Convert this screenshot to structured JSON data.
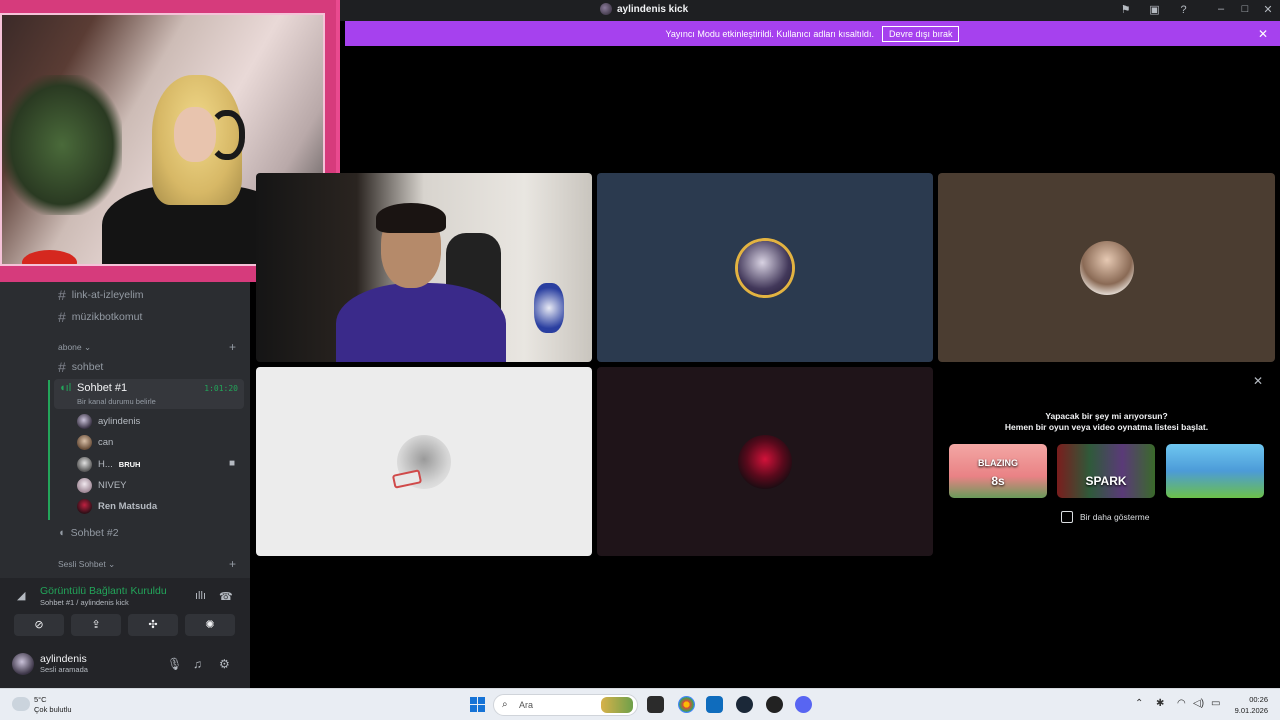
{
  "titlebar": {
    "title": "aylindenis kick"
  },
  "banner": {
    "message": "Yayıncı Modu etkinleştirildi. Kullanıcı adları kısaltıldı.",
    "disable_label": "Devre dışı bırak",
    "color": "#a641ee"
  },
  "sidebar": {
    "text_channels": [
      {
        "name": "link-at-izleyelim"
      },
      {
        "name": "müzikbotkomut"
      }
    ],
    "category_abone": "abone",
    "sohbet_channel": "sohbet",
    "active_voice": {
      "name": "Sohbet #1",
      "time": "1:01:20",
      "status_hint": "Bir kanal durumu belirle"
    },
    "voice_users": [
      {
        "name": "aylindenis",
        "badge": ""
      },
      {
        "name": "can",
        "badge": ""
      },
      {
        "name": "H...",
        "badge": "BRUH"
      },
      {
        "name": "NIVEY",
        "badge": ""
      },
      {
        "name": "Ren Matsuda",
        "badge": ""
      }
    ],
    "voice_channel_2": "Sohbet #2",
    "category_sesli": "Sesli Sohbet"
  },
  "voice_panel": {
    "status": "Görüntülü Bağlantı Kuruldu",
    "sub": "Sohbet #1 / aylindenis kick"
  },
  "user_panel": {
    "name": "aylindenis",
    "status": "Sesli aramada"
  },
  "activity": {
    "title": "Yapacak bir şey mi arıyorsun?",
    "subtitle": "Hemen bir oyun veya video oynatma listesi başlat.",
    "games": [
      {
        "label": "BLAZING",
        "label2": "8s"
      },
      {
        "label": "",
        "label2": "SPARK"
      },
      {
        "label": "",
        "label2": ""
      }
    ],
    "dont_show": "Bir daha gösterme"
  },
  "taskbar": {
    "temp": "5°C",
    "weather": "Çok bulutlu",
    "search_placeholder": "Ara",
    "clock_time": "00:26",
    "clock_date": "9.01.2026"
  }
}
